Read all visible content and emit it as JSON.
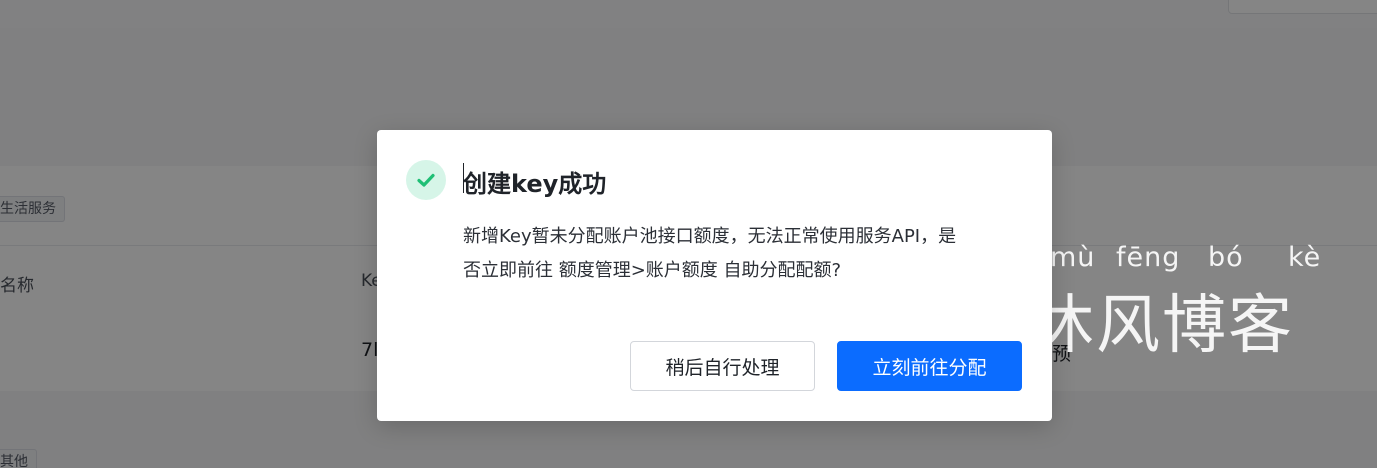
{
  "background": {
    "tag_top": "生活服务",
    "column_name": "名称",
    "column_key": "Ke",
    "row_value_left": "7l",
    "row_value_right": "预",
    "tag_bottom": "其他"
  },
  "dialog": {
    "title": "创建key成功",
    "message": "新增Key暂未分配账户池接口额度，无法正常使用服务API，是否立即前往 额度管理>账户额度 自助分配配额?",
    "secondary_button": "稍后自行处理",
    "primary_button": "立刻前往分配"
  },
  "watermark": {
    "pinyin": [
      "mù",
      "fēng",
      "bó",
      "kè"
    ],
    "chars": "沐风博客"
  },
  "colors": {
    "primary": "#0b6cff",
    "success": "#1fbf75",
    "success_bg": "#d6f5e8",
    "overlay": "rgba(0,0,0,0.48)"
  },
  "icons": {
    "success": "check-circle-icon"
  }
}
